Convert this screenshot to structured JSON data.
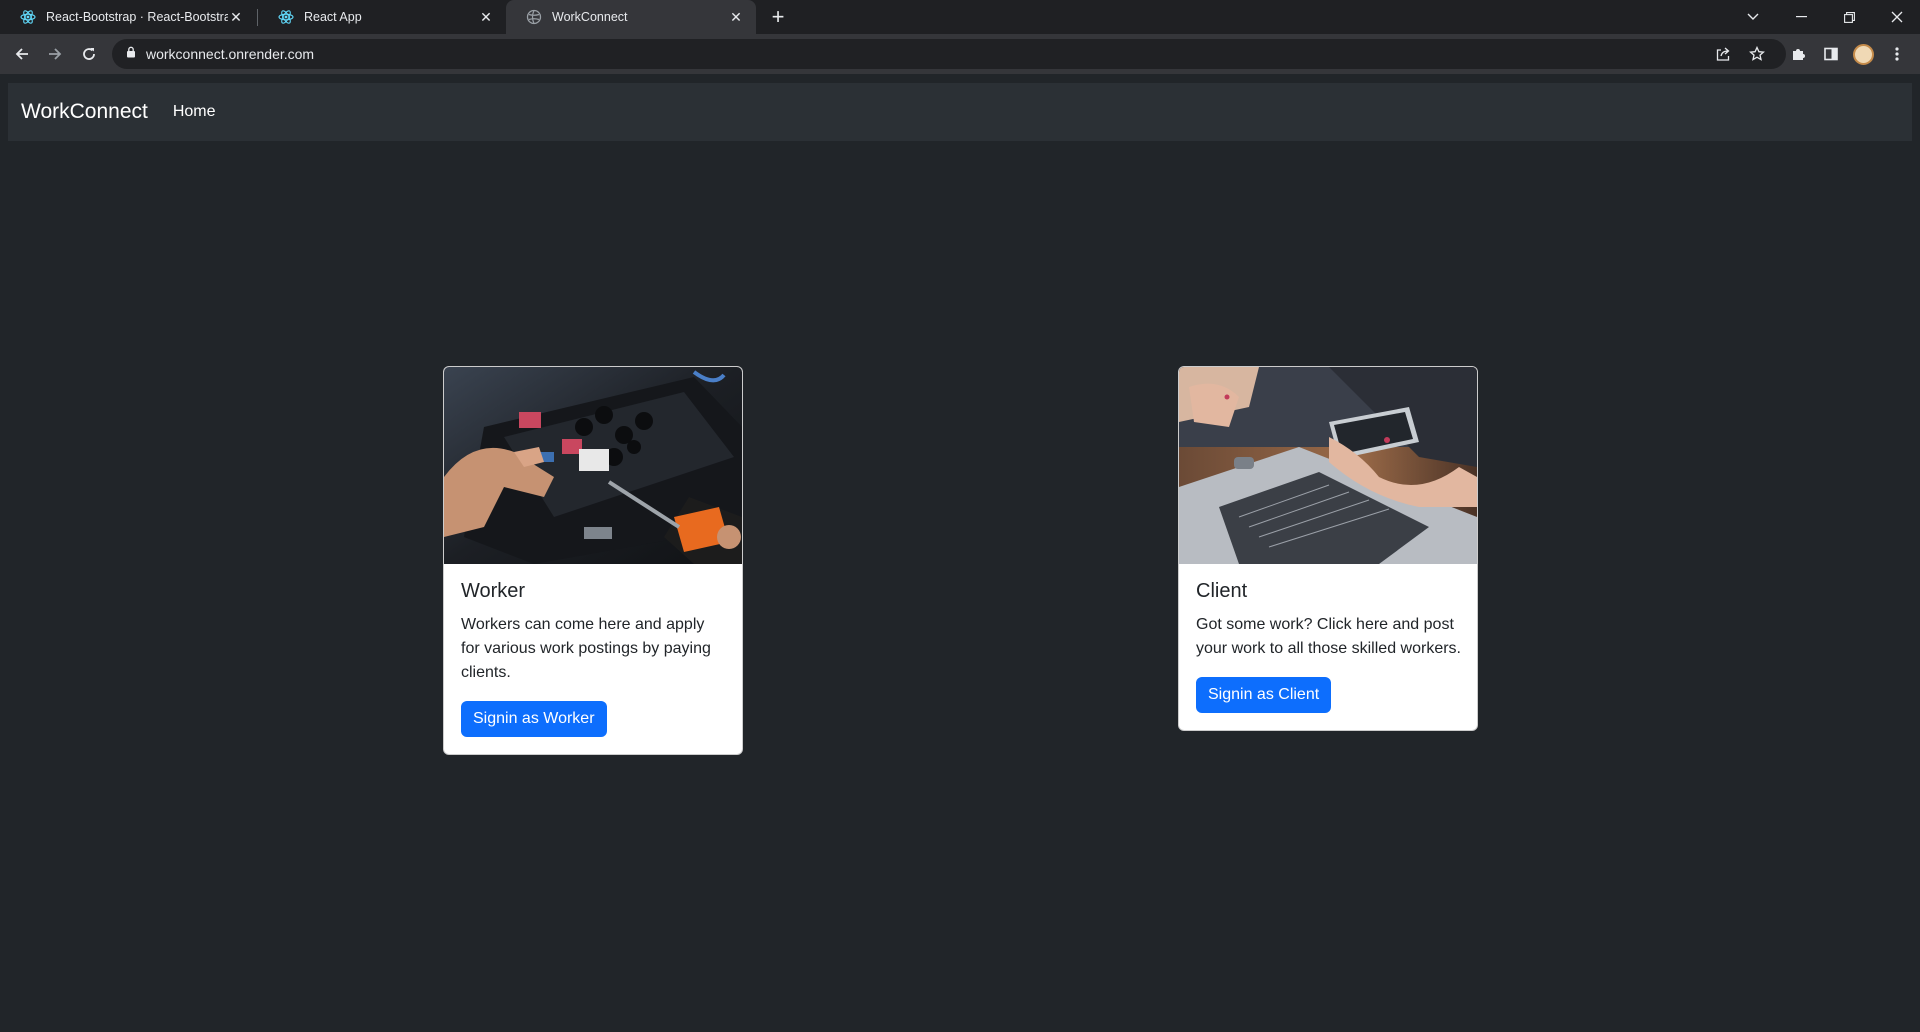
{
  "browser": {
    "tabs": [
      {
        "title": "React-Bootstrap · React-Bootstrap",
        "icon": "react-bootstrap-icon"
      },
      {
        "title": "React App",
        "icon": "react-icon"
      },
      {
        "title": "WorkConnect",
        "icon": "globe-icon"
      }
    ],
    "url": "workconnect.onrender.com"
  },
  "navbar": {
    "brand": "WorkConnect",
    "links": [
      "Home"
    ]
  },
  "cards": {
    "worker": {
      "title": "Worker",
      "text": "Workers can come here and apply for various work postings by paying clients.",
      "button": "Signin as Worker"
    },
    "client": {
      "title": "Client",
      "text": "Got some work? Click here and post your work to all those skilled workers.",
      "button": "Signin as Client"
    }
  },
  "colors": {
    "page_bg": "#212529",
    "navbar_bg": "#2b3035",
    "button": "#0d6efd"
  }
}
